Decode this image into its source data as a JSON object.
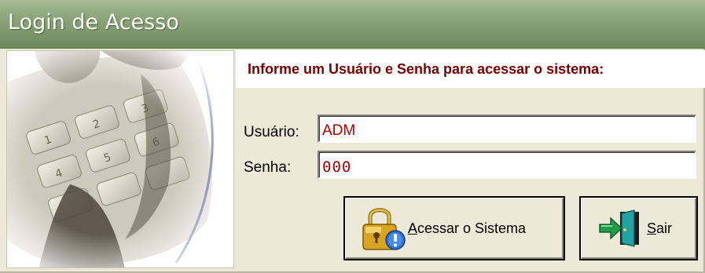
{
  "window": {
    "title": "Login de Acesso"
  },
  "header": {
    "message": "Informe um Usuário e Senha para acessar o sistema:"
  },
  "form": {
    "username_label": "Usuário:",
    "username_value": "ADM",
    "password_label": "Senha:",
    "password_value": "000"
  },
  "buttons": {
    "access_mnemonic": "A",
    "access_rest": "cessar o Sistema",
    "exit_mnemonic": "S",
    "exit_rest": "air"
  },
  "icons": {
    "image_panel": "keypad-photo",
    "access_button": "padlock-info-icon",
    "exit_button": "exit-door-icon"
  },
  "colors": {
    "title_bar": "#7b9769",
    "header_text": "#7a0000",
    "field_text": "#b00000",
    "window_bg": "#ece9d8"
  }
}
